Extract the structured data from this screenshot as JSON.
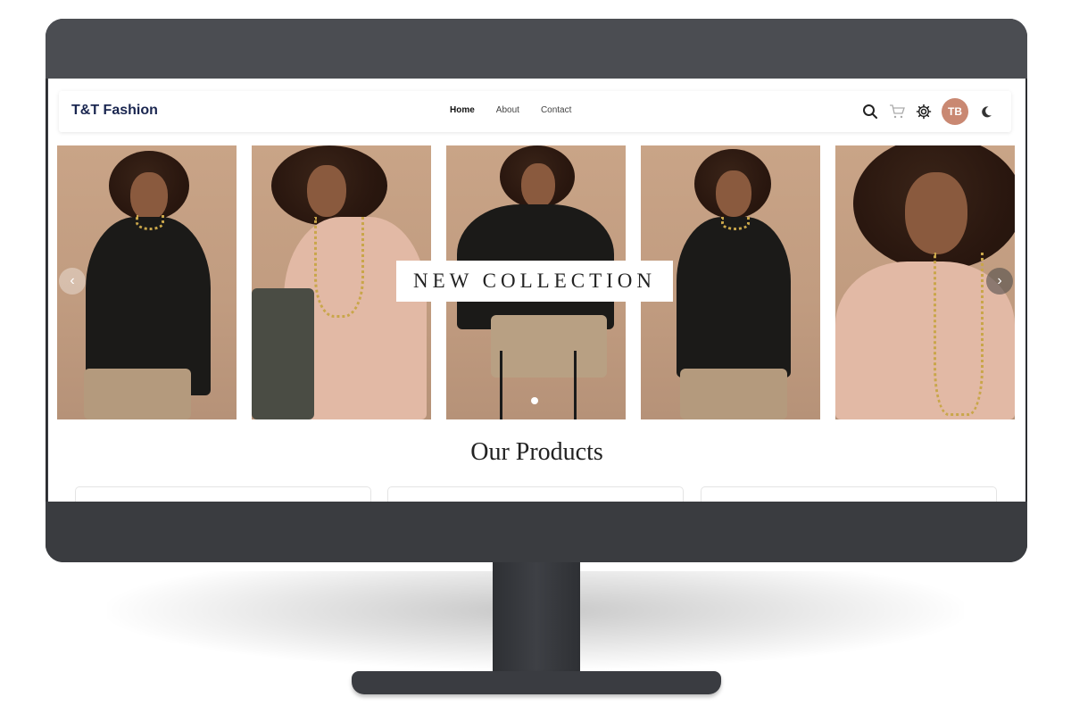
{
  "brand": "T&T Fashion",
  "nav": {
    "links": [
      "Home",
      "About",
      "Contact"
    ],
    "active": "Home"
  },
  "icons": [
    "search-icon",
    "cart-icon",
    "gear-icon",
    "moon-icon"
  ],
  "avatar_initials": "TB",
  "hero": {
    "banner": "NEW COLLECTION",
    "prev_arrow": "‹",
    "next_arrow": "›"
  },
  "products_heading": "Our Products",
  "colors": {
    "brand_text": "#1a2650",
    "avatar_bg": "#c98872",
    "photo_bg": "#c9a487"
  }
}
